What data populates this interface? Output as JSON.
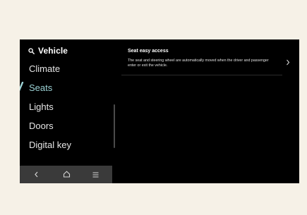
{
  "sidebar": {
    "search_title": "Vehicle",
    "items": [
      {
        "label": "Climate"
      },
      {
        "label": "Seats",
        "active": true
      },
      {
        "label": "Lights"
      },
      {
        "label": "Doors"
      },
      {
        "label": "Digital key"
      }
    ]
  },
  "navbar": {
    "back_icon": "back-chevron-icon",
    "home_icon": "home-icon",
    "menu_icon": "menu-icon"
  },
  "main": {
    "setting": {
      "title": "Seat easy access",
      "description": "The seat and steering wheel are automatically moved when the driver and passenger enter or exit the vehicle."
    }
  },
  "colors": {
    "frame_background": "#f6f1e7",
    "screen_background": "#000000",
    "accent": "#9cd2d5",
    "navbar_background": "#3a3a3a"
  }
}
